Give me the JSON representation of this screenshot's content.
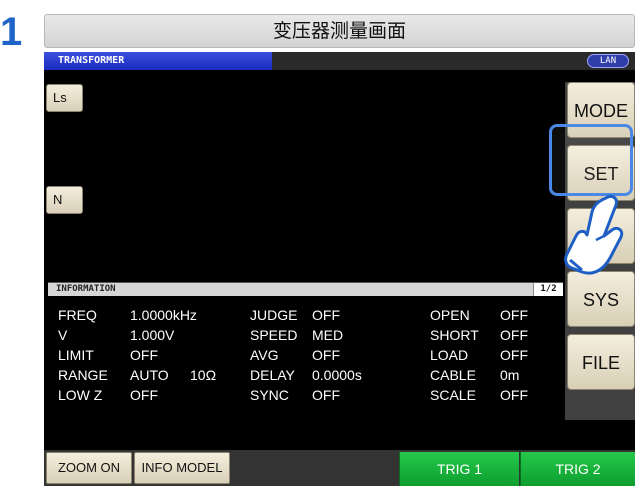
{
  "step_number": "1",
  "caption": "变压器测量画面",
  "screen": {
    "title": "TRANSFORMER",
    "lan_badge": "LAN",
    "params": [
      {
        "label": "Ls"
      },
      {
        "label": "N"
      }
    ],
    "side_buttons": {
      "mode": "MODE",
      "set": "SET",
      "adj": "ADJ",
      "sys": "SYS",
      "file": "FILE"
    },
    "information": {
      "title": "INFORMATION",
      "page": "1/2",
      "rows": [
        {
          "l1": "FREQ",
          "v1": "1.0000kHz",
          "v1b": "",
          "l2": "JUDGE",
          "v2": "OFF",
          "l3": "OPEN",
          "v3": "OFF"
        },
        {
          "l1": "V",
          "v1": "1.000V",
          "v1b": "",
          "l2": "SPEED",
          "v2": "MED",
          "l3": "SHORT",
          "v3": "OFF"
        },
        {
          "l1": "LIMIT",
          "v1": "OFF",
          "v1b": "",
          "l2": "AVG",
          "v2": "OFF",
          "l3": "LOAD",
          "v3": "OFF"
        },
        {
          "l1": "RANGE",
          "v1": "AUTO",
          "v1b": "10Ω",
          "l2": "DELAY",
          "v2": "0.0000s",
          "l3": "CABLE",
          "v3": "0m"
        },
        {
          "l1": "LOW Z",
          "v1": "OFF",
          "v1b": "",
          "l2": "SYNC",
          "v2": "OFF",
          "l3": "SCALE",
          "v3": "OFF"
        }
      ]
    },
    "bottom_buttons": {
      "zoom": "ZOOM ON",
      "info_model": "INFO MODEL",
      "trig1": "TRIG 1",
      "trig2": "TRIG 2"
    }
  },
  "colors": {
    "step_number": "#1f64c8",
    "title_bar": "#1a2bbd",
    "trig": "#16b23c",
    "highlight": "#4a88e6"
  },
  "icons": [
    "pointing-hand-icon"
  ]
}
